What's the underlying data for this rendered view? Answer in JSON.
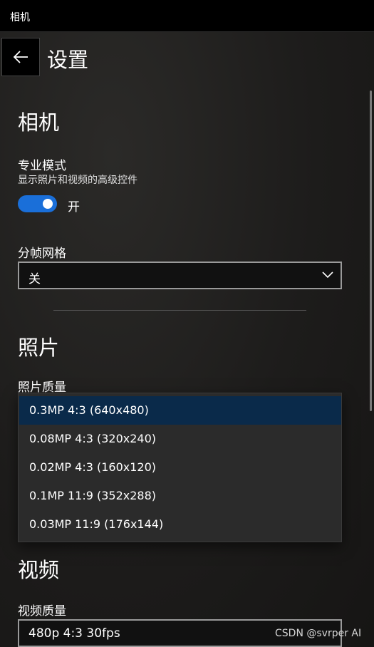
{
  "app": {
    "title": "相机"
  },
  "header": {
    "page_title": "设置"
  },
  "camera": {
    "section_title": "相机",
    "pro_mode": {
      "label": "专业模式",
      "description": "显示照片和视频的高级控件",
      "state_label": "开",
      "on": true
    },
    "framing_grid": {
      "label": "分帧网格",
      "value": "关"
    }
  },
  "photo": {
    "section_title": "照片",
    "quality_label": "照片质量",
    "options": [
      {
        "label": "0.3MP 4:3 (640x480)",
        "selected": true
      },
      {
        "label": "0.08MP 4:3 (320x240)",
        "selected": false
      },
      {
        "label": "0.02MP 4:3 (160x120)",
        "selected": false
      },
      {
        "label": "0.1MP 11:9 (352x288)",
        "selected": false
      },
      {
        "label": "0.03MP 11:9 (176x144)",
        "selected": false
      }
    ]
  },
  "video": {
    "section_title": "视频",
    "quality_label": "视频质量",
    "value": "480p 4:3 30fps"
  },
  "watermark": "CSDN @svrper AI",
  "colors": {
    "accent": "#1a6fd9",
    "selected_option": "#0a2a4a",
    "background": "#1b1a19"
  }
}
